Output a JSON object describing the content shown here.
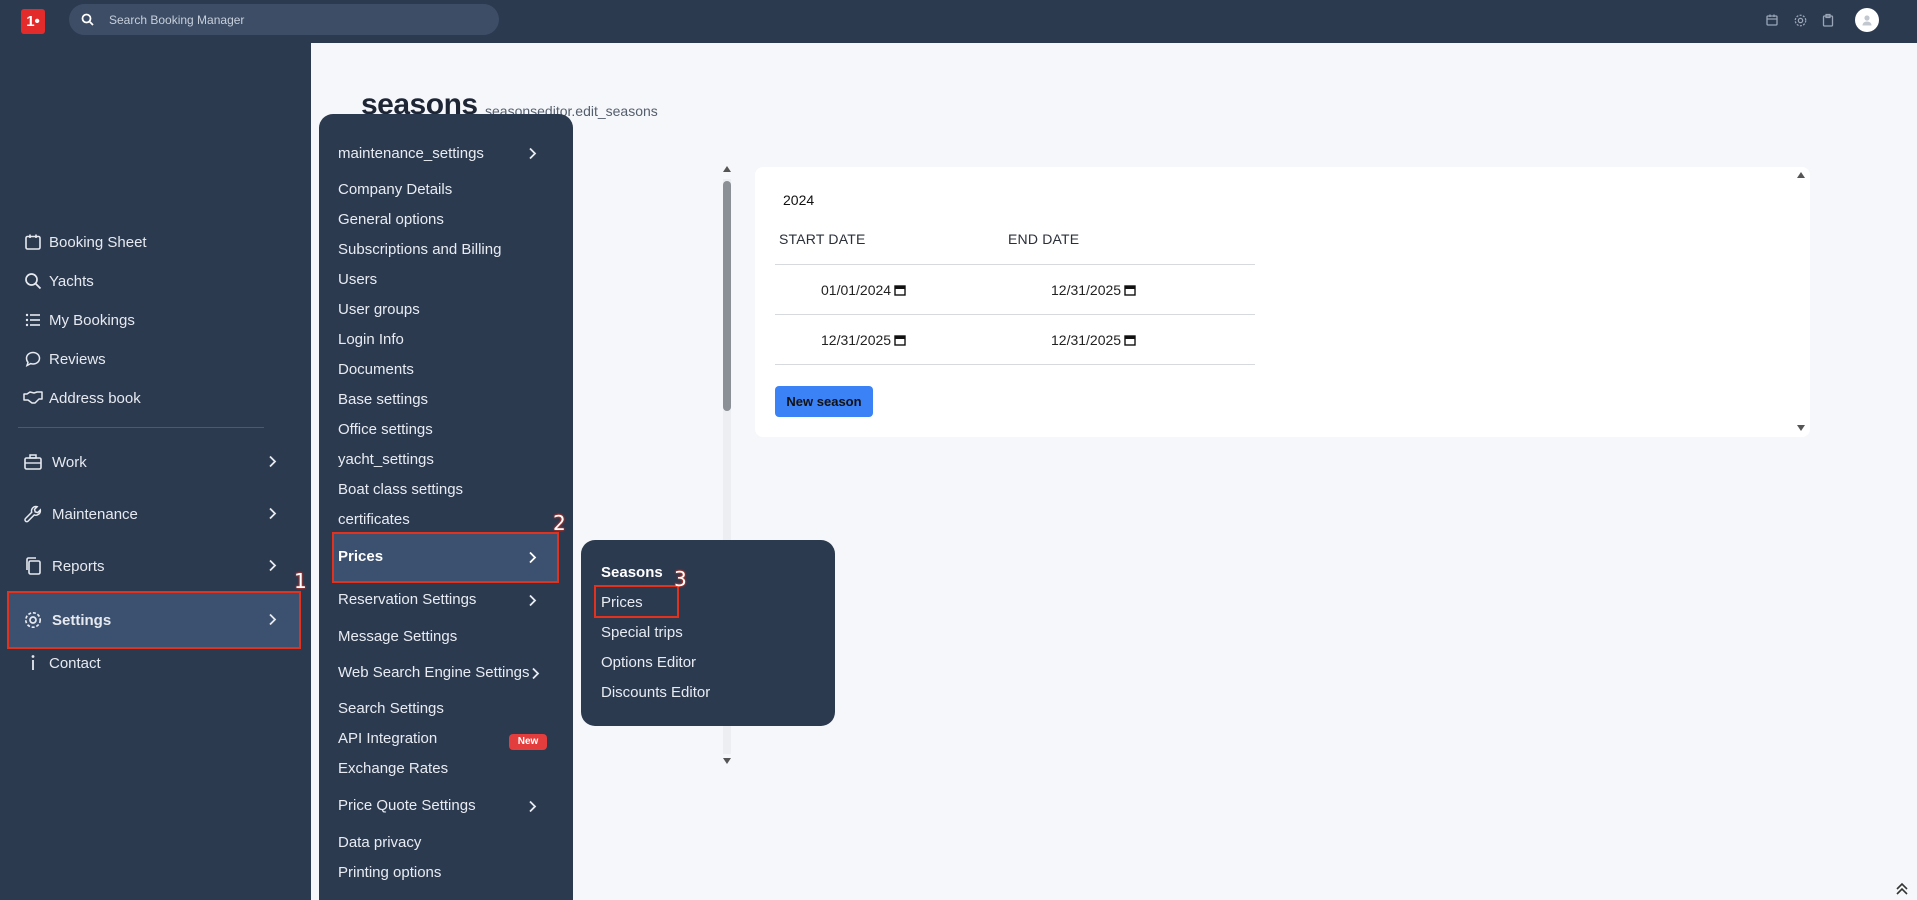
{
  "topbar": {
    "logo_text": "1•",
    "search_placeholder": "Search Booking Manager",
    "icons": [
      "calendar-icon",
      "gear-icon",
      "clipboard-icon",
      "avatar-icon"
    ]
  },
  "sidebar": {
    "items": [
      {
        "label": "Booking Sheet",
        "icon": "calendar-icon"
      },
      {
        "label": "Yachts",
        "icon": "search-icon"
      },
      {
        "label": "My Bookings",
        "icon": "list-icon"
      },
      {
        "label": "Reviews",
        "icon": "chat-icon"
      },
      {
        "label": "Address book",
        "icon": "handshake-icon"
      }
    ],
    "groups": [
      {
        "label": "Work",
        "icon": "briefcase-icon"
      },
      {
        "label": "Maintenance",
        "icon": "wrench-icon"
      },
      {
        "label": "Reports",
        "icon": "copy-icon"
      },
      {
        "label": "Settings",
        "icon": "gear-icon",
        "active": true
      }
    ],
    "contact_label": "Contact"
  },
  "page": {
    "title": "seasons",
    "subtitle": "seasonseditor.edit_seasons"
  },
  "seasons_card": {
    "year": "2024",
    "columns": [
      "START DATE",
      "END DATE"
    ],
    "rows": [
      {
        "start": "01/01/2024",
        "end": "12/31/2025"
      },
      {
        "start": "12/31/2025",
        "end": "12/31/2025"
      }
    ],
    "new_season_label": "New season"
  },
  "settings_menu": {
    "items": [
      {
        "label": "maintenance_settings",
        "has_submenu": true
      },
      {
        "label": "Company Details"
      },
      {
        "label": "General options"
      },
      {
        "label": "Subscriptions and Billing"
      },
      {
        "label": "Users"
      },
      {
        "label": "User groups"
      },
      {
        "label": "Login Info"
      },
      {
        "label": "Documents"
      },
      {
        "label": "Base settings"
      },
      {
        "label": "Office settings"
      },
      {
        "label": "yacht_settings"
      },
      {
        "label": "Boat class settings"
      },
      {
        "label": "certificates"
      },
      {
        "label": "Prices",
        "has_submenu": true,
        "active": true
      },
      {
        "label": "Reservation Settings",
        "has_submenu": true
      },
      {
        "label": "Message Settings"
      },
      {
        "label": "Web Search Engine Settings",
        "has_submenu": true
      },
      {
        "label": "Search Settings"
      },
      {
        "label": "API Integration",
        "badge": "New"
      },
      {
        "label": "Exchange Rates"
      },
      {
        "label": "Price Quote Settings",
        "has_submenu": true
      },
      {
        "label": "Data privacy"
      },
      {
        "label": "Printing options"
      }
    ]
  },
  "prices_submenu": {
    "items": [
      {
        "label": "Seasons",
        "active": true
      },
      {
        "label": "Prices",
        "highlighted": true
      },
      {
        "label": "Special trips"
      },
      {
        "label": "Options Editor"
      },
      {
        "label": "Discounts Editor"
      }
    ]
  },
  "step_markers": [
    "1",
    "2",
    "3"
  ],
  "colors": {
    "sidebar_bg": "#2c3a50",
    "highlight_outline": "#e0321f",
    "accent_button": "#3b82f6",
    "badge_new": "#e43d3d"
  }
}
